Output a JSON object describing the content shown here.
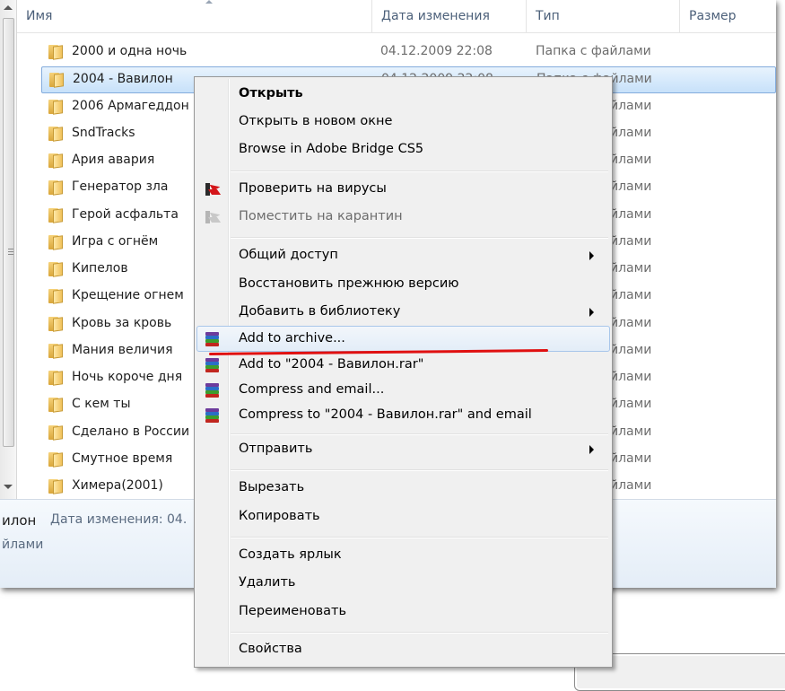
{
  "columns": {
    "name": "Имя",
    "date": "Дата изменения",
    "type": "Тип",
    "size": "Размер"
  },
  "files": [
    {
      "name": "2000 и одна ночь",
      "date": "04.12.2009 22:08",
      "type": "Папка с файлами"
    },
    {
      "name": "2004 - Вавилон",
      "date": "04.12.2009 22:08",
      "type": "Папка с файлами",
      "selected": true
    },
    {
      "name": "2006 Армагеддон",
      "type": "йлами"
    },
    {
      "name": "SndTracks",
      "type": "йлами"
    },
    {
      "name": "Ария авария",
      "type": "йлами"
    },
    {
      "name": "Генератор зла",
      "type": "йлами"
    },
    {
      "name": "Герой асфальта",
      "type": "йлами"
    },
    {
      "name": "Игра с огнём",
      "type": "йлами"
    },
    {
      "name": "Кипелов",
      "type": "йлами"
    },
    {
      "name": "Крещение огнем",
      "type": "йлами"
    },
    {
      "name": "Кровь за кровь",
      "type": "йлами"
    },
    {
      "name": "Мания величия",
      "type": "йлами"
    },
    {
      "name": "Ночь короче дня",
      "type": "йлами"
    },
    {
      "name": "С кем ты",
      "type": "йлами"
    },
    {
      "name": "Сделано в России",
      "type": "йлами"
    },
    {
      "name": "Смутное время",
      "type": "йлами"
    },
    {
      "name": "Химера(2001)",
      "type": "йлами"
    }
  ],
  "details": {
    "name": "илон",
    "label": "Дата изменения: 04.",
    "type": "йлами"
  },
  "menu": {
    "open": "Открыть",
    "open_new_window": "Открыть в новом окне",
    "browse_bridge": "Browse in Adobe Bridge CS5",
    "scan_viruses": "Проверить на вирусы",
    "quarantine": "Поместить на карантин",
    "share": "Общий доступ",
    "restore_version": "Восстановить прежнюю версию",
    "add_library": "Добавить в библиотеку",
    "add_archive": "Add to archive...",
    "add_to_rar": "Add to \"2004 - Вавилон.rar\"",
    "compress_email": "Compress and email...",
    "compress_rar_email": "Compress to \"2004 - Вавилон.rar\" and email",
    "send_to": "Отправить",
    "cut": "Вырезать",
    "copy": "Копировать",
    "create_shortcut": "Создать ярлык",
    "delete": "Удалить",
    "rename": "Переименовать",
    "properties": "Свойства"
  },
  "icons": {
    "folder": "folder-icon",
    "antivirus": "kaspersky-icon",
    "archive": "winrar-icon",
    "submenu": "chevron-right-icon"
  },
  "colors": {
    "selection": "#c7e1fa",
    "menu_bg": "#f0f0f0",
    "annotation": "#e01010",
    "header_text": "#4c607a"
  }
}
